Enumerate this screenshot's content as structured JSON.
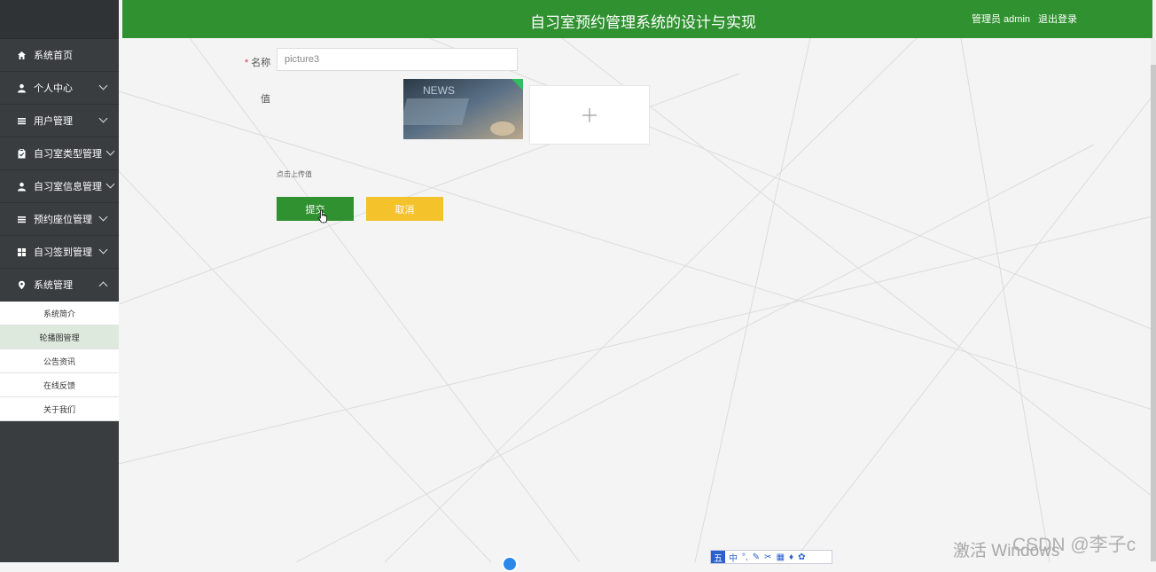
{
  "header": {
    "title": "自习室预约管理系统的设计与实现",
    "user": "管理员 admin",
    "logout": "退出登录",
    "color": "#2f9130"
  },
  "sidebar": {
    "items": [
      {
        "label": "系统首页",
        "icon": "home-icon"
      },
      {
        "label": "个人中心",
        "icon": "user-icon"
      },
      {
        "label": "用户管理",
        "icon": "list-icon"
      },
      {
        "label": "自习室类型管理",
        "icon": "clipboard-icon"
      },
      {
        "label": "自习室信息管理",
        "icon": "user-icon"
      },
      {
        "label": "预约座位管理",
        "icon": "list-icon"
      },
      {
        "label": "自习签到管理",
        "icon": "grid-icon"
      },
      {
        "label": "系统管理",
        "icon": "pin-icon"
      }
    ],
    "submenu": [
      "系统简介",
      "轮播图管理",
      "公告资讯",
      "在线反馈",
      "关于我们"
    ],
    "active_sub": "轮播图管理"
  },
  "form": {
    "name_label": "名称",
    "name_value": "picture3",
    "value_label": "值",
    "upload_hint": "点击上传值",
    "submit": "提交",
    "cancel": "取消",
    "thumb_text": "NEWS"
  },
  "overlay": {
    "watermark": "激活 Windows",
    "csdn": "CSDN @李子c",
    "ime_tag": "五",
    "ime_text": "中"
  }
}
